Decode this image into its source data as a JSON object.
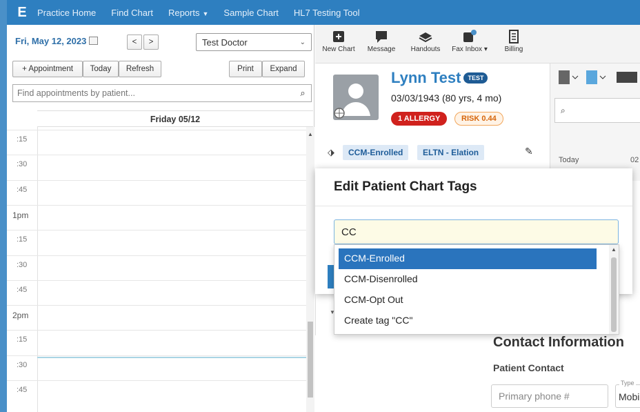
{
  "nav": {
    "logo": "E",
    "items": [
      "Practice Home",
      "Find Chart",
      "Reports",
      "Sample Chart",
      "HL7 Testing Tool"
    ]
  },
  "calendar": {
    "date": "Fri, May 12, 2023",
    "prev": "<",
    "next": ">",
    "doctor": "Test Doctor",
    "buttons": {
      "appointment": "+ Appointment",
      "today": "Today",
      "refresh": "Refresh",
      "print": "Print",
      "expand": "Expand"
    },
    "search_placeholder": "Find appointments by patient...",
    "day_header": "Friday 05/12",
    "times": [
      ":15",
      ":30",
      ":45",
      "1pm",
      ":15",
      ":30",
      ":45",
      "2pm",
      ":15",
      ":30",
      ":45"
    ]
  },
  "toolbar": {
    "items": [
      "New Chart",
      "Message",
      "Handouts",
      "Fax Inbox",
      "Billing"
    ]
  },
  "patient": {
    "name": "Lynn Test",
    "badge": "TEST",
    "dob": "03/03/1943 (80 yrs, 4 mo)",
    "allergy": "1 ALLERGY",
    "risk": "RISK 0.44",
    "tags": [
      "CCM-Enrolled",
      "ELTN - Elation"
    ]
  },
  "right_side": {
    "today": "Today",
    "o2": "02"
  },
  "modal": {
    "title": "Edit Patient Chart Tags",
    "input_value": "CC",
    "options": [
      "CCM-Enrolled",
      "CCM-Disenrolled",
      "CCM-Opt Out",
      "Create tag \"CC\""
    ],
    "active_index": 0
  },
  "contact": {
    "title": "Contact Information",
    "subtitle": "Patient Contact",
    "phone_placeholder": "Primary phone #",
    "type_label": "Type",
    "type_value": "Mobile"
  },
  "colors": {
    "nav_bg": "#2e7fc0",
    "brand_blue": "#2e7fc0",
    "allergy_red": "#d0211d",
    "risk_orange": "#d6650a",
    "dropdown_active": "#2a74bd"
  }
}
